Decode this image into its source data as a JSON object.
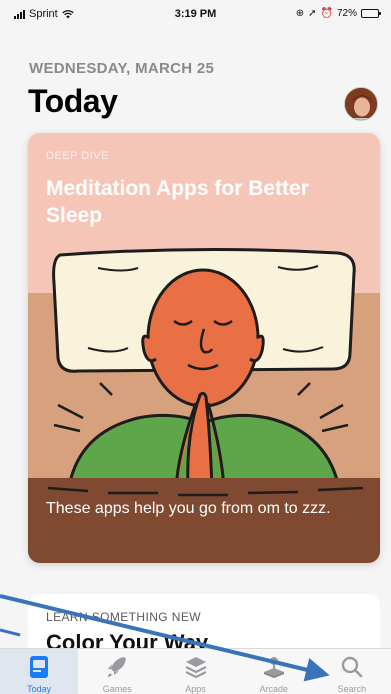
{
  "status_bar": {
    "carrier": "Sprint",
    "time": "3:19 PM",
    "battery": "72%",
    "battery_level": 0.72
  },
  "header": {
    "date": "WEDNESDAY, MARCH 25",
    "title": "Today"
  },
  "feature_card": {
    "eyebrow": "DEEP DIVE",
    "title": "Meditation Apps for Better Sleep",
    "caption": "These apps help you go from om to zzz."
  },
  "next_card": {
    "eyebrow": "LEARN SOMETHING NEW",
    "title": "Color Your Way"
  },
  "tab_bar": {
    "tabs": [
      {
        "label": "Today",
        "icon": "today-icon",
        "active": true
      },
      {
        "label": "Games",
        "icon": "rocket-icon",
        "active": false
      },
      {
        "label": "Apps",
        "icon": "layers-icon",
        "active": false
      },
      {
        "label": "Arcade",
        "icon": "joystick-icon",
        "active": false
      },
      {
        "label": "Search",
        "icon": "search-icon",
        "active": false
      }
    ]
  },
  "colors": {
    "accent": "#1a7cf2",
    "card_background": "#f5c6b7",
    "annotation_arrow": "#3b73b8"
  }
}
